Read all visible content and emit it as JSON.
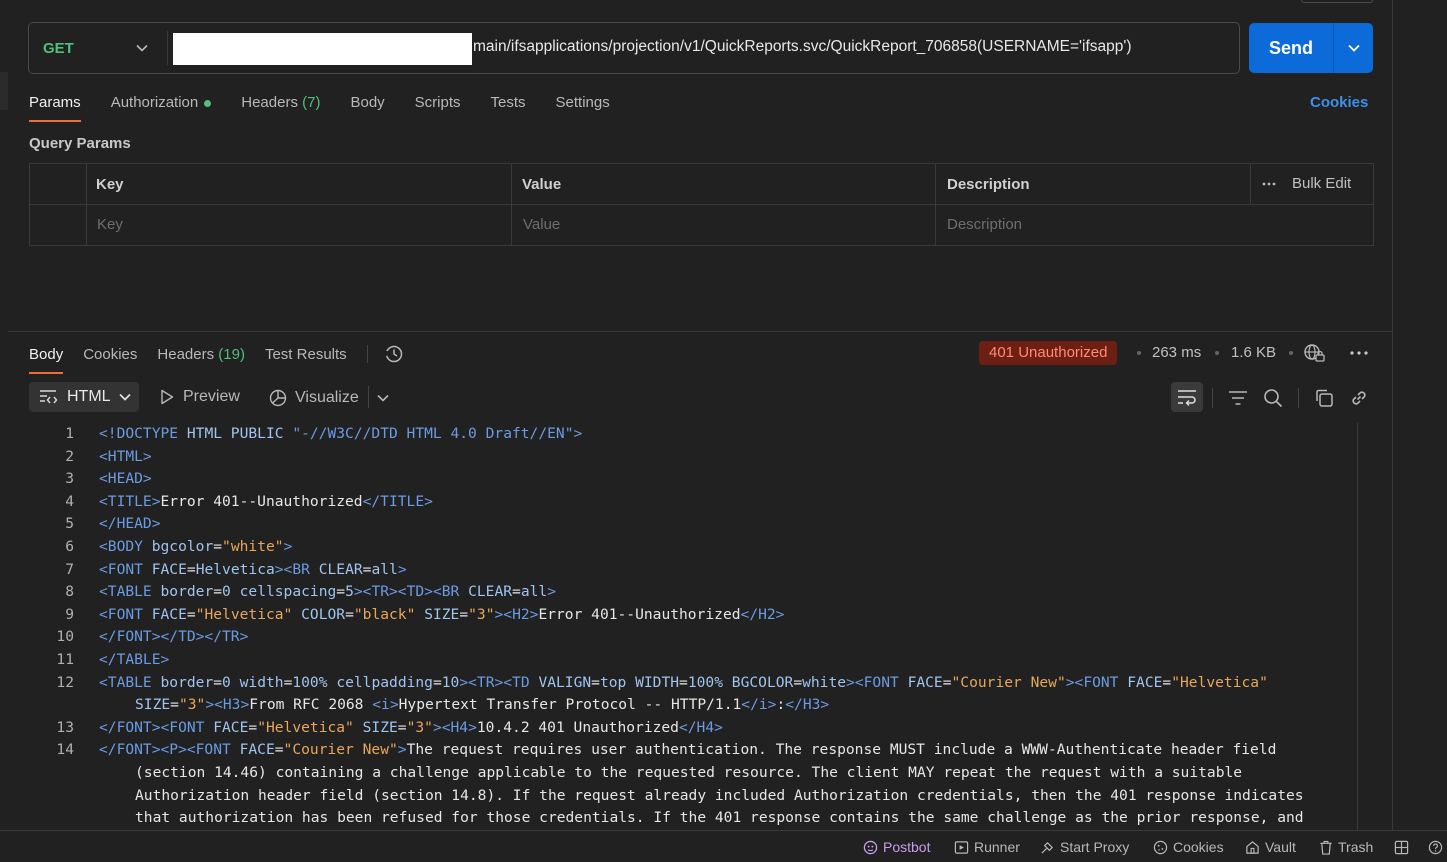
{
  "request": {
    "method": "GET",
    "url": "main/ifsapplications/projection/v1/QuickReports.svc/QuickReport_706858(USERNAME='ifsapp')",
    "send_label": "Send"
  },
  "request_tabs": {
    "params": "Params",
    "authorization": "Authorization",
    "headers": "Headers",
    "headers_count": "(7)",
    "body": "Body",
    "scripts": "Scripts",
    "tests": "Tests",
    "settings": "Settings",
    "cookies": "Cookies"
  },
  "query_params": {
    "title": "Query Params",
    "columns": [
      "Key",
      "Value",
      "Description"
    ],
    "bulk_edit": "Bulk Edit",
    "placeholders": [
      "Key",
      "Value",
      "Description"
    ]
  },
  "response": {
    "tabs": {
      "body": "Body",
      "cookies": "Cookies",
      "headers": "Headers",
      "headers_count": "(19)",
      "test_results": "Test Results"
    },
    "status": "401 Unauthorized",
    "time": "263 ms",
    "size": "1.6 KB",
    "format": "HTML",
    "preview": "Preview",
    "visualize": "Visualize",
    "lines": [
      {
        "n": "1",
        "html": "<span class='tg'>&lt;!DOCTYPE</span> <span class='at'>HTML PUBLIC</span> <span class='tg'>\"-//W3C//DTD HTML 4.0 Draft//EN\"&gt;</span>"
      },
      {
        "n": "2",
        "html": "<span class='tg'>&lt;HTML&gt;</span>"
      },
      {
        "n": "3",
        "html": "<span class='tg'>&lt;HEAD&gt;</span>"
      },
      {
        "n": "4",
        "html": "<span class='tg'>&lt;TITLE&gt;</span>Error 401--Unauthorized<span class='tg'>&lt;/TITLE&gt;</span>"
      },
      {
        "n": "5",
        "html": "<span class='tg'>&lt;/HEAD&gt;</span>"
      },
      {
        "n": "6",
        "html": "<span class='tg'>&lt;BODY</span> <span class='at'>bgcolor</span>=<span class='st'>\"white\"</span><span class='tg'>&gt;</span>"
      },
      {
        "n": "7",
        "html": "<span class='tg'>&lt;FONT</span> <span class='at'>FACE</span>=<span class='at'>Helvetica</span><span class='tg'>&gt;&lt;BR</span> <span class='at'>CLEAR</span>=<span class='at'>all</span><span class='tg'>&gt;</span>"
      },
      {
        "n": "8",
        "html": "<span class='tg'>&lt;TABLE</span> <span class='at'>border</span>=<span class='at'>0</span> <span class='at'>cellspacing</span>=<span class='at'>5</span><span class='tg'>&gt;&lt;TR&gt;&lt;TD&gt;&lt;BR</span> <span class='at'>CLEAR</span>=<span class='at'>all</span><span class='tg'>&gt;</span>"
      },
      {
        "n": "9",
        "html": "<span class='tg'>&lt;FONT</span> <span class='at'>FACE</span>=<span class='st'>\"Helvetica\"</span> <span class='at'>COLOR</span>=<span class='st'>\"black\"</span> <span class='at'>SIZE</span>=<span class='st'>\"3\"</span><span class='tg'>&gt;&lt;H2&gt;</span>Error 401--Unauthorized<span class='tg'>&lt;/H2&gt;</span>"
      },
      {
        "n": "10",
        "html": "<span class='tg'>&lt;/FONT&gt;&lt;/TD&gt;&lt;/TR&gt;</span>"
      },
      {
        "n": "11",
        "html": "<span class='tg'>&lt;/TABLE&gt;</span>"
      },
      {
        "n": "12",
        "html": "<span class='tg'>&lt;TABLE</span> <span class='at'>border</span>=<span class='at'>0</span> <span class='at'>width</span>=<span class='at'>100%</span> <span class='at'>cellpadding</span>=<span class='at'>10</span><span class='tg'>&gt;&lt;TR&gt;&lt;TD</span> <span class='at'>VALIGN</span>=<span class='at'>top</span> <span class='at'>WIDTH</span>=<span class='at'>100%</span> <span class='at'>BGCOLOR</span>=<span class='at'>white</span><span class='tg'>&gt;&lt;FONT</span> <span class='at'>FACE</span>=<span class='st'>\"Courier New\"</span><span class='tg'>&gt;&lt;FONT</span> <span class='at'>FACE</span>=<span class='st'>\"Helvetica\"</span>"
      },
      {
        "n": "",
        "cont": true,
        "html": "<span class='at'>SIZE</span>=<span class='st'>\"3\"</span><span class='tg'>&gt;&lt;H3&gt;</span>From RFC 2068 <span class='tg'>&lt;i&gt;</span>Hypertext Transfer Protocol -- HTTP/1.1<span class='tg'>&lt;/i&gt;</span>:<span class='tg'>&lt;/H3&gt;</span>"
      },
      {
        "n": "13",
        "html": "<span class='tg'>&lt;/FONT&gt;&lt;FONT</span> <span class='at'>FACE</span>=<span class='st'>\"Helvetica\"</span> <span class='at'>SIZE</span>=<span class='st'>\"3\"</span><span class='tg'>&gt;&lt;H4&gt;</span>10.4.2 401 Unauthorized<span class='tg'>&lt;/H4&gt;</span>"
      },
      {
        "n": "14",
        "html": "<span class='tg'>&lt;/FONT&gt;&lt;P&gt;&lt;FONT</span> <span class='at'>FACE</span>=<span class='st'>\"Courier New\"</span><span class='tg'>&gt;</span>The request requires user authentication. The response MUST include a WWW-Authenticate header field"
      },
      {
        "n": "",
        "cont": true,
        "html": "(section 14.46) containing a challenge applicable to the requested resource. The client MAY repeat the request with a suitable"
      },
      {
        "n": "",
        "cont": true,
        "html": "Authorization header field (section 14.8). If the request already included Authorization credentials, then the 401 response indicates"
      },
      {
        "n": "",
        "cont": true,
        "html": "that authorization has been refused for those credentials. If the 401 response contains the same challenge as the prior response, and"
      }
    ]
  },
  "footer": {
    "postbot": "Postbot",
    "runner": "Runner",
    "start_proxy": "Start Proxy",
    "cookies": "Cookies",
    "vault": "Vault",
    "trash": "Trash"
  },
  "colors": {
    "accent": "#f26b3a",
    "send": "#0d6ad9",
    "status_bg": "#6e1f14",
    "status_fg": "#ff8b74",
    "method": "#4fbf7a",
    "link": "#3d8fe8"
  },
  "icons": [
    "chevron-down-icon",
    "more-icon",
    "history-icon",
    "globe-lock-icon",
    "code-format-icon",
    "play-icon",
    "visualize-icon",
    "wrap-lines-icon",
    "filter-icon",
    "search-icon",
    "copy-icon",
    "link-icon",
    "postbot-icon",
    "runner-icon",
    "proxy-icon",
    "cookie-icon",
    "vault-icon",
    "trash-icon",
    "layout-icon",
    "help-icon"
  ]
}
